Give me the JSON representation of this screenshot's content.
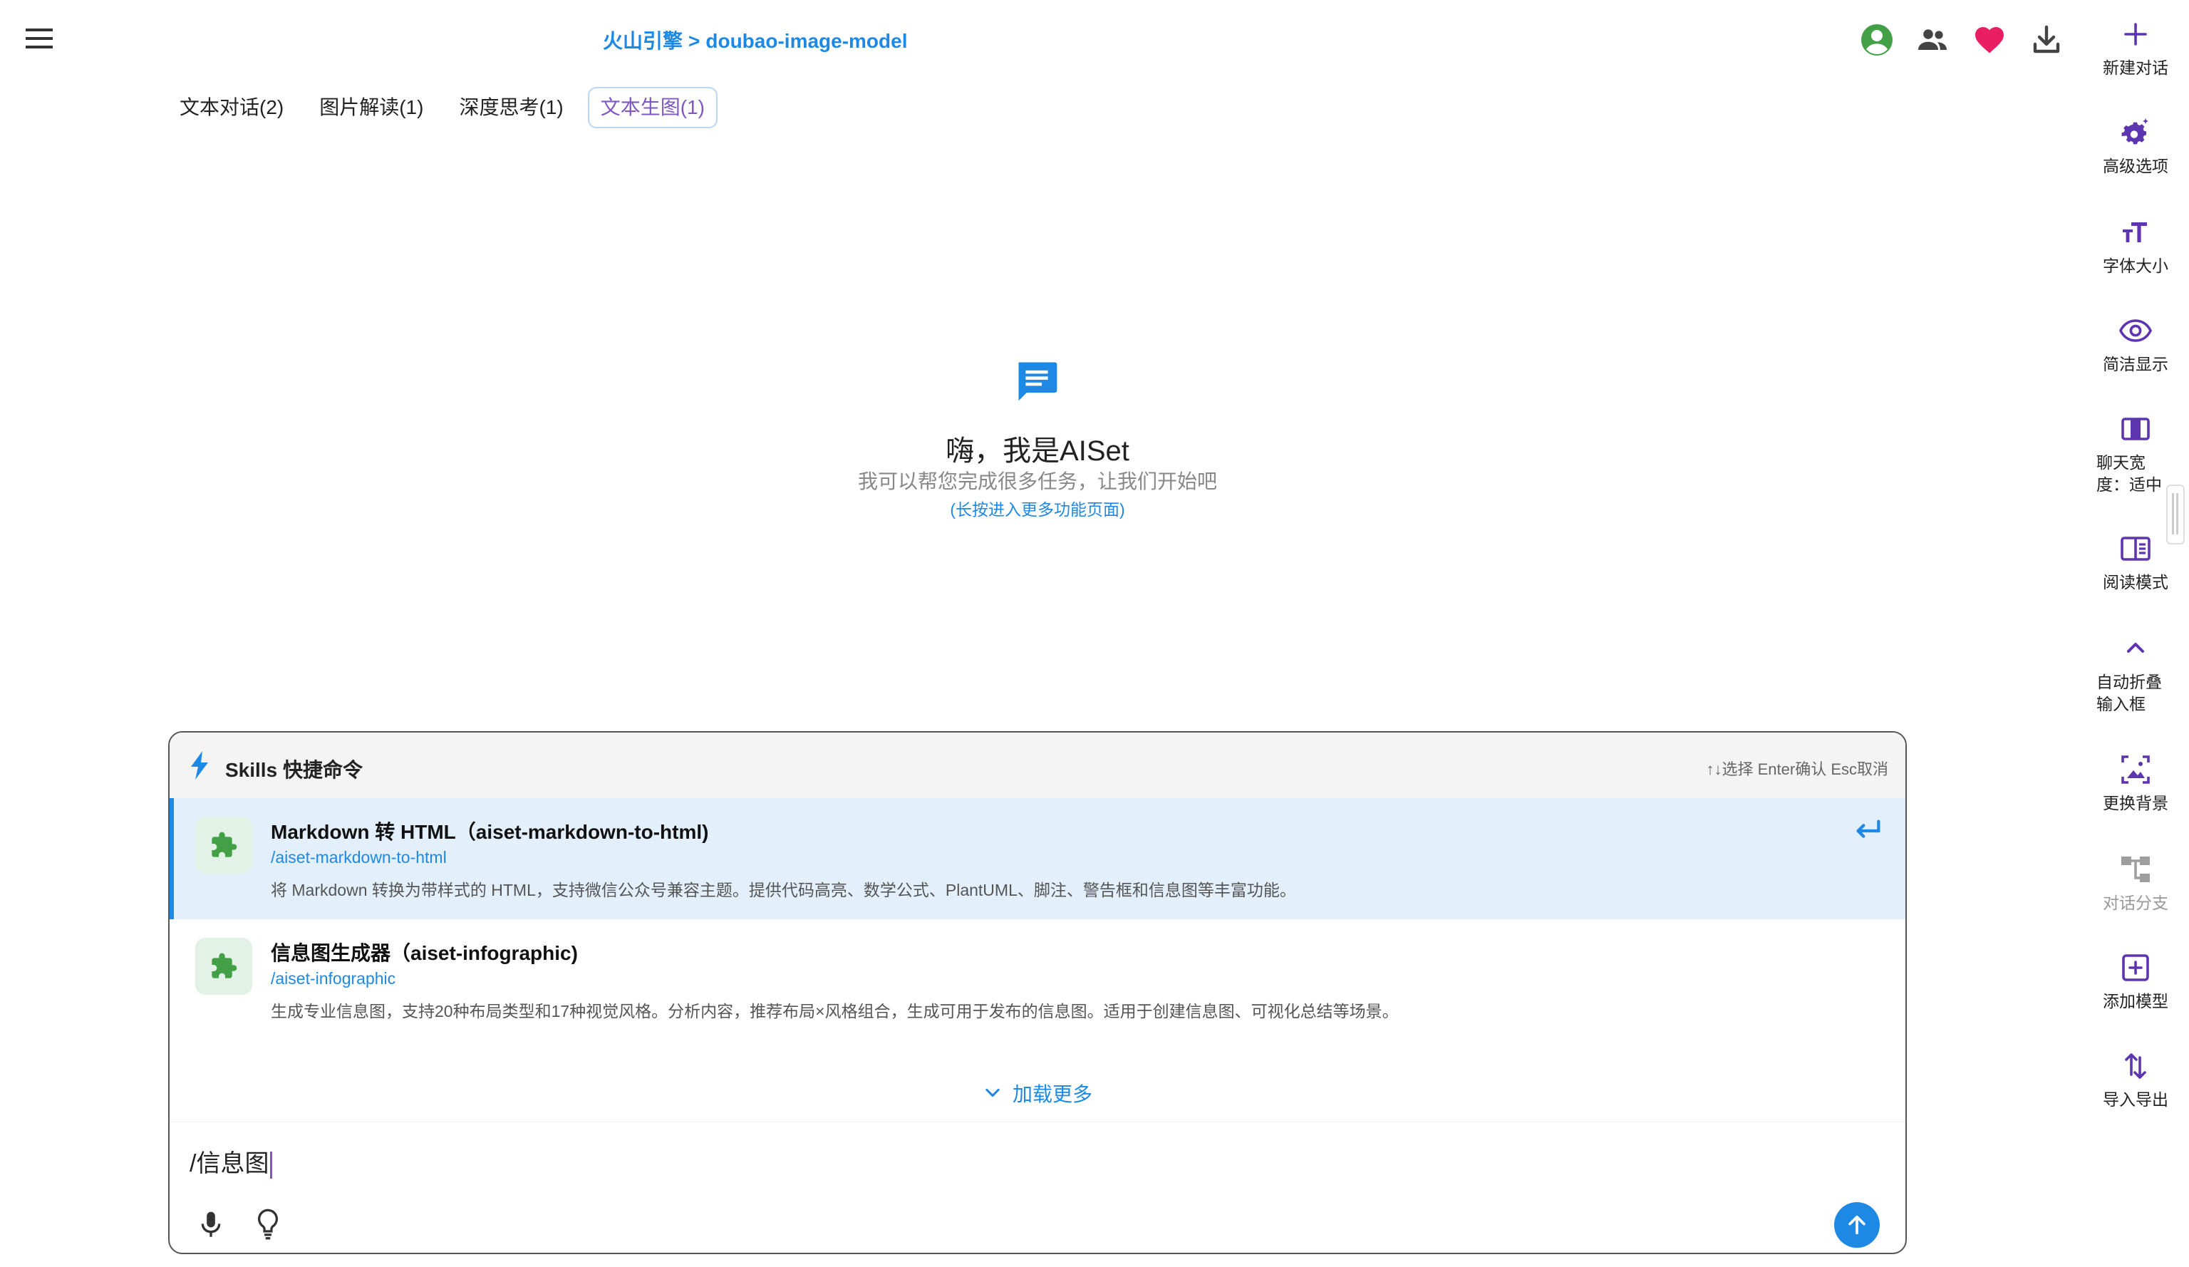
{
  "header": {
    "breadcrumb_provider": "火山引擎",
    "breadcrumb_sep": ">",
    "breadcrumb_model": "doubao-image-model"
  },
  "tabs": [
    {
      "label": "文本对话(2)",
      "active": false
    },
    {
      "label": "图片解读(1)",
      "active": false
    },
    {
      "label": "深度思考(1)",
      "active": false
    },
    {
      "label": "文本生图(1)",
      "active": true
    }
  ],
  "welcome": {
    "title": "嗨，我是AISet",
    "subtitle": "我可以帮您完成很多任务，让我们开始吧",
    "link": "(长按进入更多功能页面)"
  },
  "skills": {
    "title": "Skills 快捷命令",
    "hint": "↑↓选择 Enter确认 Esc取消",
    "items": [
      {
        "title": "Markdown 转 HTML（aiset-markdown-to-html)",
        "command": "/aiset-markdown-to-html",
        "description": "将 Markdown 转换为带样式的 HTML，支持微信公众号兼容主题。提供代码高亮、数学公式、PlantUML、脚注、警告框和信息图等丰富功能。",
        "selected": true
      },
      {
        "title": "信息图生成器（aiset-infographic)",
        "command": "/aiset-infographic",
        "description": "生成专业信息图，支持20种布局类型和17种视觉风格。分析内容，推荐布局×风格组合，生成可用于发布的信息图。适用于创建信息图、可视化总结等场景。",
        "selected": false
      }
    ],
    "load_more": "加载更多"
  },
  "input": {
    "value": "/信息图"
  },
  "sidebar": {
    "items": [
      {
        "label": "新建对话"
      },
      {
        "label": "高级选项"
      },
      {
        "label": "字体大小"
      },
      {
        "label": "简洁显示"
      },
      {
        "label_line1": "聊天宽",
        "label_line2": "度：适中"
      },
      {
        "label": "阅读模式"
      },
      {
        "label_line1": "自动折叠",
        "label_line2": "输入框"
      },
      {
        "label": "更换背景"
      },
      {
        "label": "对话分支",
        "disabled": true
      },
      {
        "label": "添加模型"
      },
      {
        "label": "导入导出"
      }
    ]
  },
  "colors": {
    "accent": "#1e88e5",
    "active_tab_text": "#7e57c2",
    "user_icon": "#43a047",
    "heart": "#e91e63",
    "puzzle": "#43a047",
    "gear": "#5e35b1"
  },
  "icons": {
    "menu": "menu-icon",
    "user": "account-circle-icon",
    "group": "group-icon",
    "heart": "heart-icon",
    "download": "download-icon",
    "welcome": "chat-bubble-icon",
    "skills": "bolt-icon",
    "skill_item": "puzzle-icon",
    "enter": "enter-icon",
    "mic": "mic-icon",
    "bulb": "lightbulb-icon",
    "send": "arrow-up-icon"
  }
}
